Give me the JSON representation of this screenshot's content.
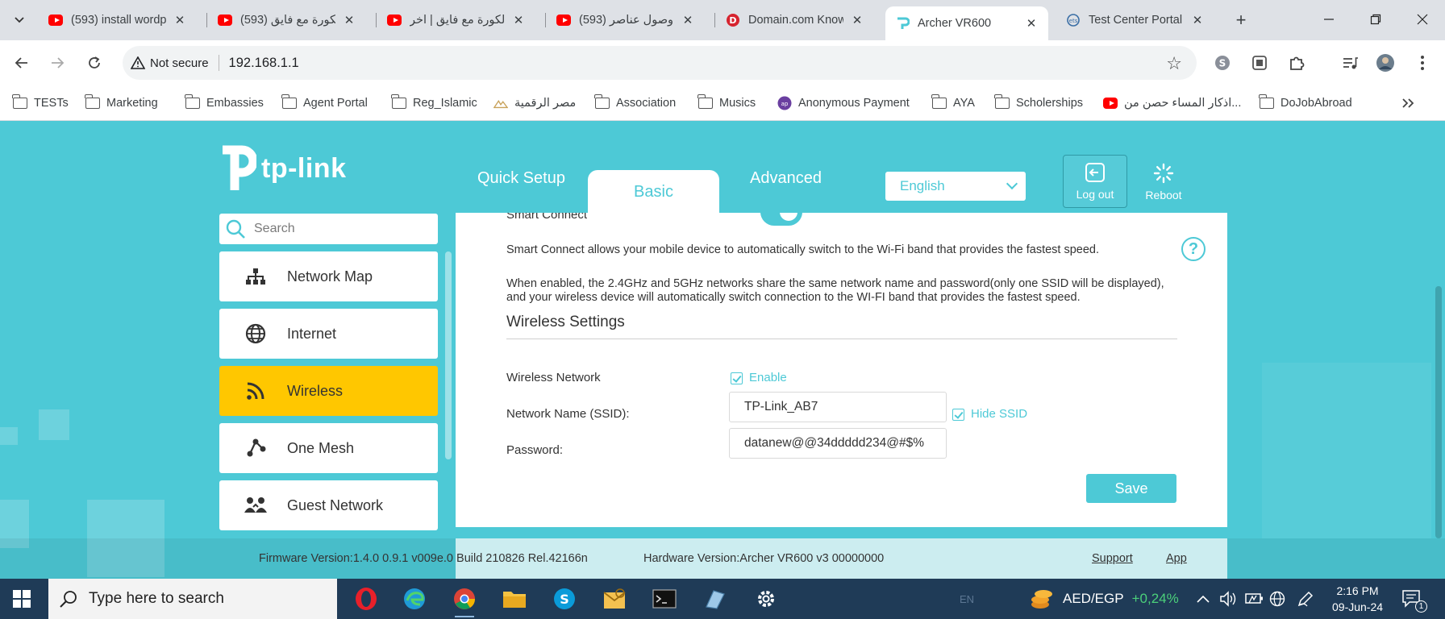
{
  "browser": {
    "tabs": [
      {
        "label": "(593) install wordp",
        "favicon": "youtube-icon"
      },
      {
        "label": "(593) الكورة مع فايق",
        "favicon": "youtube-icon"
      },
      {
        "label": "الكورة مع فايق | آخر",
        "favicon": "youtube-icon"
      },
      {
        "label": "(593) وصول عناصر",
        "favicon": "youtube-icon"
      },
      {
        "label": "Domain.com Know",
        "favicon": "domain-icon"
      },
      {
        "label": "Archer VR600",
        "favicon": "tplink-icon",
        "active": true
      },
      {
        "label": "Test Center Portal",
        "favicon": "ets-icon"
      }
    ],
    "not_secure": "Not secure",
    "url": "192.168.1.1",
    "bookmarks": [
      {
        "label": "TESTs",
        "icon": "folder-icon"
      },
      {
        "label": "Marketing",
        "icon": "folder-icon"
      },
      {
        "label": "Embassies",
        "icon": "folder-icon"
      },
      {
        "label": "Agent Portal",
        "icon": "folder-icon"
      },
      {
        "label": "Reg_Islamic",
        "icon": "folder-icon"
      },
      {
        "label": "مصر الرقمية",
        "icon": "egypt-digital-icon"
      },
      {
        "label": "Association",
        "icon": "folder-icon"
      },
      {
        "label": "Musics",
        "icon": "folder-icon"
      },
      {
        "label": "Anonymous Payment",
        "icon": "payment-icon"
      },
      {
        "label": "AYA",
        "icon": "folder-icon"
      },
      {
        "label": "Scholerships",
        "icon": "folder-icon"
      },
      {
        "label": "اذكار المساء حصن من...",
        "icon": "youtube-icon"
      },
      {
        "label": "DoJobAbroad",
        "icon": "folder-icon"
      }
    ]
  },
  "router": {
    "logo": "tp-link",
    "nav": {
      "quick_setup": "Quick Setup",
      "basic": "Basic",
      "advanced": "Advanced"
    },
    "language": "English",
    "logout": "Log out",
    "reboot": "Reboot",
    "search_placeholder": "Search",
    "menu": [
      {
        "label": "Network Map",
        "icon": "network-map-icon"
      },
      {
        "label": "Internet",
        "icon": "globe-icon"
      },
      {
        "label": "Wireless",
        "icon": "wifi-icon",
        "active": true
      },
      {
        "label": "One Mesh",
        "icon": "mesh-icon"
      },
      {
        "label": "Guest Network",
        "icon": "guest-network-icon"
      }
    ],
    "smart_connect": {
      "title": "Smart Connect",
      "enabled": true,
      "desc1": "Smart Connect allows your mobile device to automatically switch to the Wi-Fi band that provides the fastest speed.",
      "desc2": "When enabled, the 2.4GHz and 5GHz networks share the same network name and password(only one SSID will be displayed), and your wireless device will automatically switch connection to the WI-FI band that provides the fastest speed."
    },
    "wireless_settings": {
      "title": "Wireless Settings",
      "network_label": "Wireless Network",
      "enable_label": "Enable",
      "enable_checked": true,
      "ssid_label": "Network Name (SSID):",
      "ssid_value": "TP-Link_AB7",
      "hide_ssid_label": "Hide SSID",
      "hide_ssid_checked": true,
      "password_label": "Password:",
      "password_value": "datanew@@34ddddd234@#$%",
      "save_label": "Save"
    },
    "footer": {
      "firmware": "Firmware Version:1.4.0 0.9.1 v009e.0 Build 210826 Rel.42166n",
      "hardware": "Hardware Version:Archer VR600 v3 00000000",
      "support": "Support",
      "app": "App"
    }
  },
  "taskbar": {
    "search_placeholder": "Type here to search",
    "lang": "EN",
    "currency": "AED/EGP",
    "currency_change": "+0,24%",
    "time": "2:16 PM",
    "date": "09-Jun-24",
    "notifications": "1"
  },
  "colors": {
    "accent": "#4dc9d6",
    "active_menu": "#ffc700",
    "taskbar": "#1f3b57"
  }
}
